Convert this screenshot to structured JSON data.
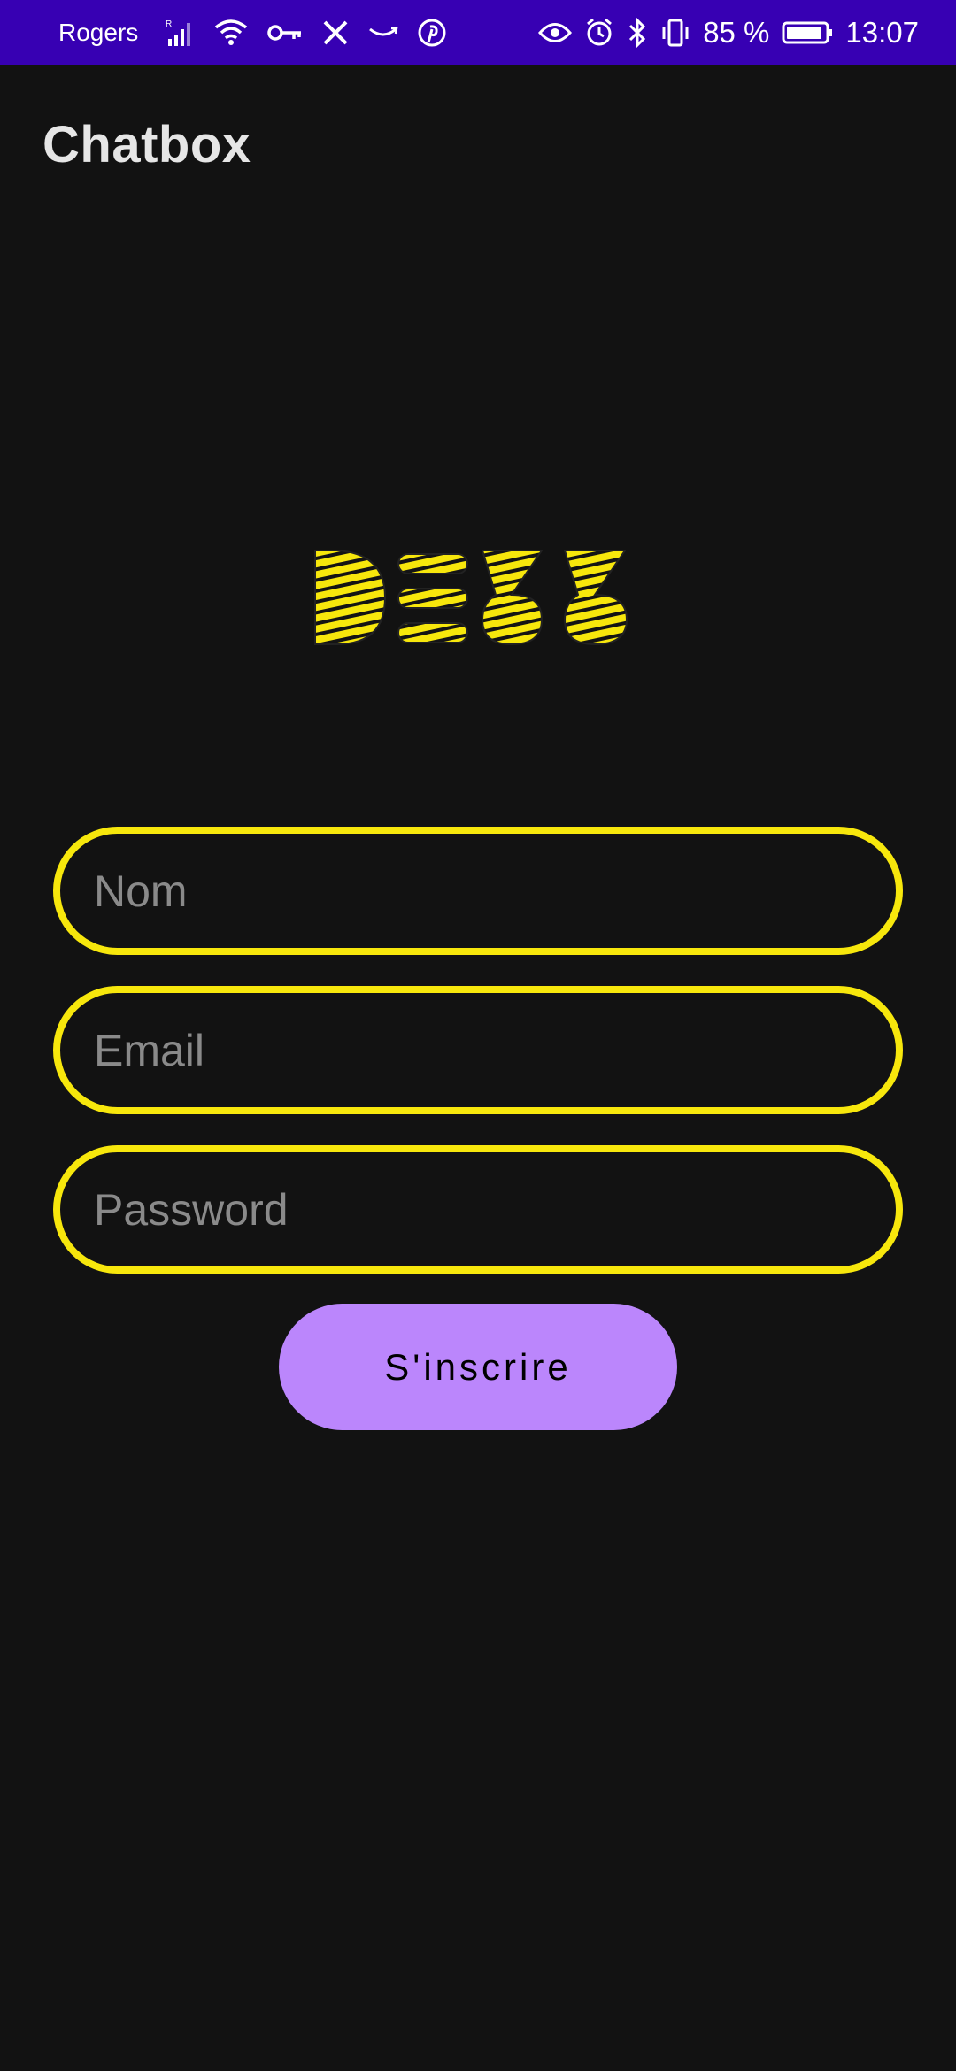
{
  "status_bar": {
    "carrier": "Rogers",
    "battery_text": "85 %",
    "time": "13:07",
    "icons_left": [
      "signal-icon",
      "wifi-icon",
      "vpn-key-icon",
      "app-notification-icon",
      "amazon-icon",
      "pinterest-icon"
    ],
    "icons_right": [
      "eye-icon",
      "alarm-icon",
      "bluetooth-icon",
      "vibrate-icon",
      "battery-icon"
    ]
  },
  "app_bar": {
    "title": "Chatbox"
  },
  "logo": {
    "text": "DESS",
    "color": "#f7e70c"
  },
  "form": {
    "name_placeholder": "Nom",
    "email_placeholder": "Email",
    "password_placeholder": "Password",
    "submit_label": "S'inscrire"
  },
  "colors": {
    "status_bar": "#3700b3",
    "background": "#121212",
    "field_border": "#f7e70c",
    "button": "#bb86fc"
  }
}
